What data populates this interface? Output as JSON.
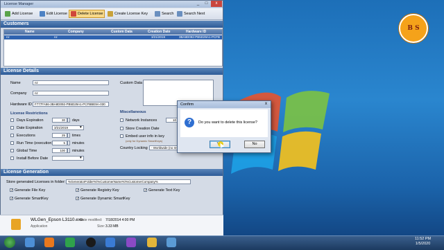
{
  "window": {
    "title": "License Manager",
    "controls": [
      "_",
      "□",
      "x"
    ]
  },
  "toolbar": {
    "buttons": [
      {
        "label": "Add License",
        "icon": "add-license-icon"
      },
      {
        "label": "Edit License",
        "icon": "edit-license-icon"
      },
      {
        "label": "Delete License",
        "icon": "delete-license-icon",
        "active": true
      },
      {
        "label": "Create License Key",
        "icon": "key-icon"
      },
      {
        "label": "Search",
        "icon": "search-icon"
      },
      {
        "label": "Search Next",
        "icon": "search-next-icon"
      }
    ]
  },
  "customers": {
    "title": "Customers",
    "columns": [
      "Name",
      "Company",
      "Custom Data",
      "Creation Date",
      "Hardware ID"
    ],
    "rows": [
      {
        "name": "nz",
        "company": "nz",
        "custom_data": "",
        "creation_date": "3/21/2019",
        "hardware_id": "3BA8D092-PB5D29A1-PCFB"
      }
    ]
  },
  "details": {
    "title": "License Details",
    "name_label": "Name",
    "name_value": "nz",
    "company_label": "Company",
    "company_value": "nz",
    "hwid_label": "Hardware ID",
    "hwid_value": "F777FA56-3BA8D092-PB5D29A1-PCFBBE9A-030",
    "custom_label": "Custom Data",
    "restrictions_title": "License Restrictions",
    "restrictions": [
      {
        "label": "Days Expiration",
        "value": "30",
        "unit": "days"
      },
      {
        "label": "Date Expiration",
        "value": "3/21/2019",
        "unit": ""
      },
      {
        "label": "Executions",
        "value": "25",
        "unit": "times"
      },
      {
        "label": "Run Time (execution)",
        "value": "5",
        "unit": "minutes"
      },
      {
        "label": "Global Time",
        "value": "100",
        "unit": "minutes"
      },
      {
        "label": "Install Before Date",
        "value": "",
        "unit": ""
      }
    ],
    "misc_title": "Miscellaneous",
    "misc": [
      {
        "label": "Network Instances",
        "value": "10"
      },
      {
        "label": "Store Creation Date",
        "value": ""
      },
      {
        "label": "Embed user info in key",
        "value": ""
      }
    ],
    "embed_note": "(only for Dynamic SmartKeys)",
    "country_label": "Country Locking",
    "country_value": "- Worldwide (no re"
  },
  "generation": {
    "title": "License Generation",
    "store_label": "Store generated Licenses in folder:",
    "store_value": "%GeneratorFolder%\\%CustomerName%\\%CustomerCompany%",
    "options": [
      {
        "label": "Generate File Key",
        "checked": true
      },
      {
        "label": "Generate Registry Key",
        "checked": true
      },
      {
        "label": "Generate Text Key",
        "checked": true
      },
      {
        "label": "Generate SmartKey",
        "checked": true
      },
      {
        "label": "Generate Dynamic SmartKey",
        "checked": true
      }
    ]
  },
  "file": {
    "name": "WLGen_Epson L3110.exe",
    "type": "Application",
    "modified_label": "Date modified:",
    "modified_value": "7/18/2014 4:00 PM",
    "size_label": "Size:",
    "size_value": "3.33 MB"
  },
  "dialog": {
    "title": "Confirm",
    "close": "x",
    "message": "Do you want to delete this license?",
    "yes": "Yes",
    "no": "No"
  },
  "desktop_logo": "B  S",
  "taskbar": {
    "time": "11:52 PM",
    "date": "1/5/2020"
  }
}
